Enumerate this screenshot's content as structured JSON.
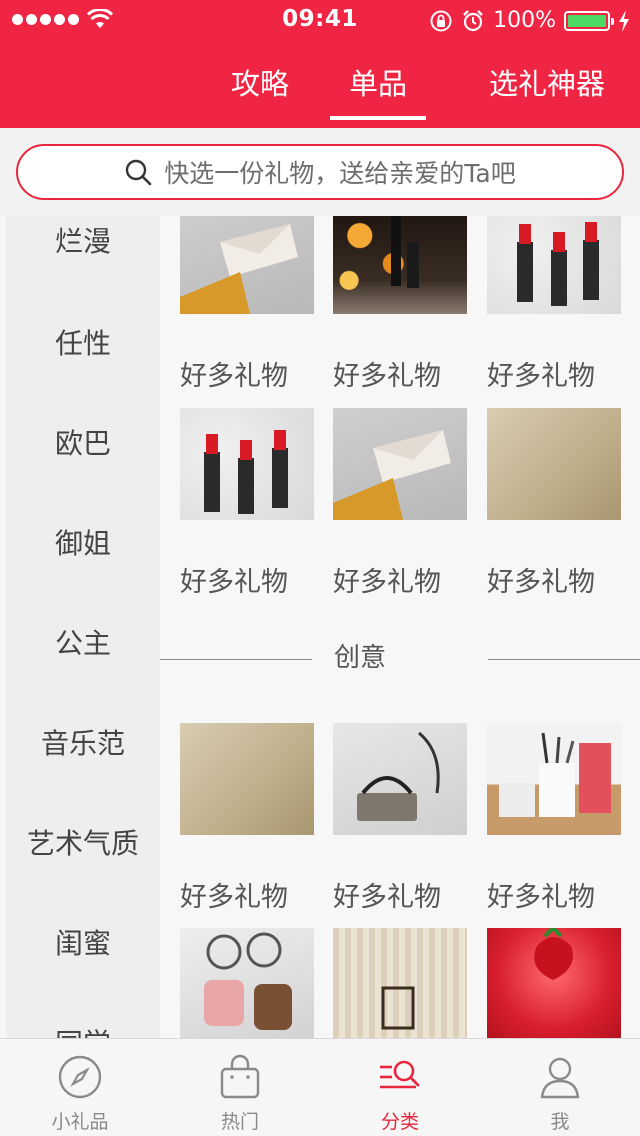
{
  "status_bar": {
    "time": "09:41",
    "battery_percent": "100%"
  },
  "top_tabs": [
    {
      "label": "攻略",
      "active": false
    },
    {
      "label": "单品",
      "active": true
    },
    {
      "label": "选礼神器",
      "active": false
    }
  ],
  "search": {
    "placeholder": "快选一份礼物，送给亲爱的Ta吧"
  },
  "sidebar": {
    "items": [
      "烂漫",
      "任性",
      "欧巴",
      "御姐",
      "公主",
      "音乐范",
      "艺术气质",
      "闺蜜",
      "同学"
    ]
  },
  "content": {
    "rows": [
      {
        "labels": [
          "好多礼物",
          "好多礼物",
          "好多礼物"
        ]
      },
      {
        "labels": [
          "好多礼物",
          "好多礼物",
          "好多礼物"
        ]
      },
      {
        "labels": [
          "好多礼物",
          "好多礼物",
          "好多礼物"
        ]
      }
    ],
    "section_title": "创意"
  },
  "tab_bar": {
    "items": [
      {
        "label": "小礼品",
        "icon": "compass-icon",
        "active": false
      },
      {
        "label": "热门",
        "icon": "shopping-bag-icon",
        "active": false
      },
      {
        "label": "分类",
        "icon": "category-search-icon",
        "active": true
      },
      {
        "label": "我",
        "icon": "user-icon",
        "active": false
      }
    ]
  },
  "colors": {
    "brand_red": "#f02543",
    "active_tab": "#e8273f",
    "battery_green": "#4cd964"
  }
}
